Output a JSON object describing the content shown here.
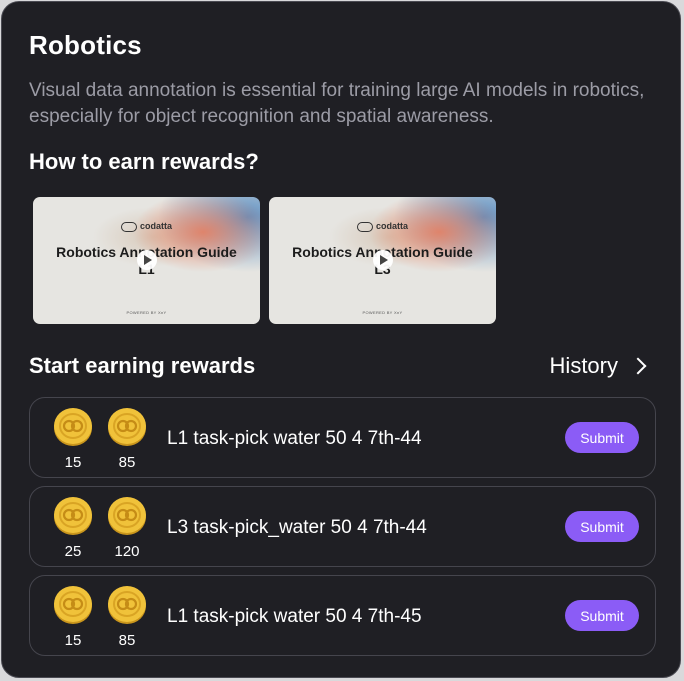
{
  "section": {
    "title": "Robotics",
    "description": "Visual data annotation is essential for training large AI models in robotics, especially for object recognition and spatial awareness."
  },
  "guides": {
    "heading": "How to earn rewards?",
    "cards": [
      {
        "logo_text": "codatta",
        "title": "Robotics Annotation Guide",
        "level": "L1",
        "footer": "POWERED BY XnY"
      },
      {
        "logo_text": "codatta",
        "title": "Robotics Annotation Guide",
        "level": "L3",
        "footer": "POWERED BY XnY"
      }
    ]
  },
  "earning": {
    "heading": "Start earning rewards",
    "history_label": "History",
    "tasks": [
      {
        "reward_a": "15",
        "reward_b": "85",
        "label": "L1 task-pick water 50 4 7th-44",
        "submit_label": "Submit"
      },
      {
        "reward_a": "25",
        "reward_b": "120",
        "label": "L3 task-pick_water 50 4 7th-44",
        "submit_label": "Submit"
      },
      {
        "reward_a": "15",
        "reward_b": "85",
        "label": "L1 task-pick water 50 4 7th-45",
        "submit_label": "Submit"
      }
    ]
  },
  "colors": {
    "panel_bg": "#1f1f24",
    "accent": "#8b5cf6",
    "coin": "#f0c23a",
    "muted_text": "#9c9ca6"
  }
}
